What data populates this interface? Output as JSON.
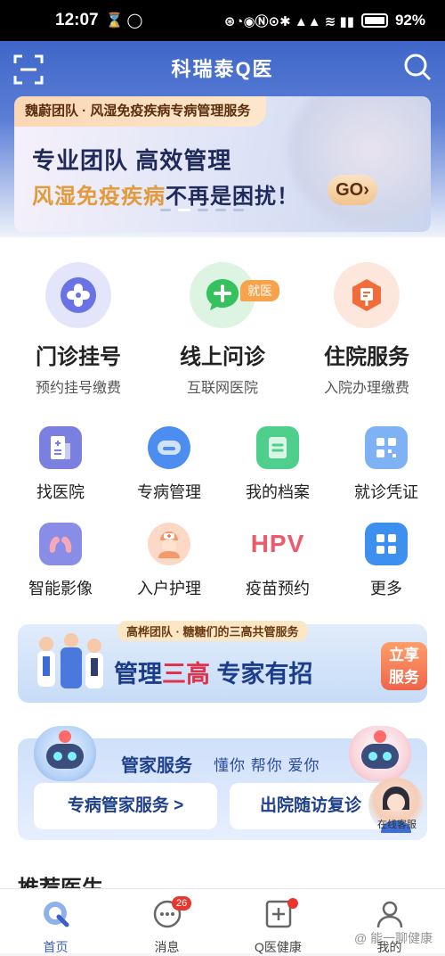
{
  "status": {
    "time": "12:07",
    "battery": "92%"
  },
  "header": {
    "title": "科瑞泰Q医"
  },
  "banner": {
    "tag": "魏蔚团队 · 风湿免疫疾病专病管理服务",
    "line1": "专业团队 高效管理",
    "line2_highlight": "风湿免疫疾病",
    "line2_rest": "不再是困扰！",
    "go": "GO"
  },
  "main": [
    {
      "label": "门诊挂号",
      "sub": "预约挂号缴费"
    },
    {
      "label": "线上问诊",
      "sub": "互联网医院",
      "badge": "就医"
    },
    {
      "label": "住院服务",
      "sub": "入院办理缴费"
    }
  ],
  "grid": [
    {
      "label": "找医院",
      "icon": "hospital-icon"
    },
    {
      "label": "专病管理",
      "icon": "robot-icon"
    },
    {
      "label": "我的档案",
      "icon": "file-icon"
    },
    {
      "label": "就诊凭证",
      "icon": "qrcode-icon"
    },
    {
      "label": "智能影像",
      "icon": "lung-icon"
    },
    {
      "label": "入户护理",
      "icon": "nurse-icon"
    },
    {
      "label": "疫苗预约",
      "icon": "hpv-icon"
    },
    {
      "label": "更多",
      "icon": "more-icon"
    }
  ],
  "grid_hpv_text": "HPV",
  "promo": {
    "tag": "高桦团队 · 糖糖们的三高共管服务",
    "main_a": "管理",
    "main_b": "三高",
    "main_c": " 专家有招",
    "btn_line1": "立享",
    "btn_line2": "服务"
  },
  "butler": {
    "title": "管家服务",
    "sub": "懂你 帮你 爱你",
    "btn1": "专病管家服务 >",
    "btn2": "出院随访复诊",
    "cs_label": "在线客服"
  },
  "recommend": "推荐医生",
  "tabs": [
    {
      "label": "首页",
      "active": true
    },
    {
      "label": "消息",
      "count": "26"
    },
    {
      "label": "Q医健康"
    },
    {
      "label": "我的"
    }
  ],
  "watermark": "@ 能一聊健康"
}
